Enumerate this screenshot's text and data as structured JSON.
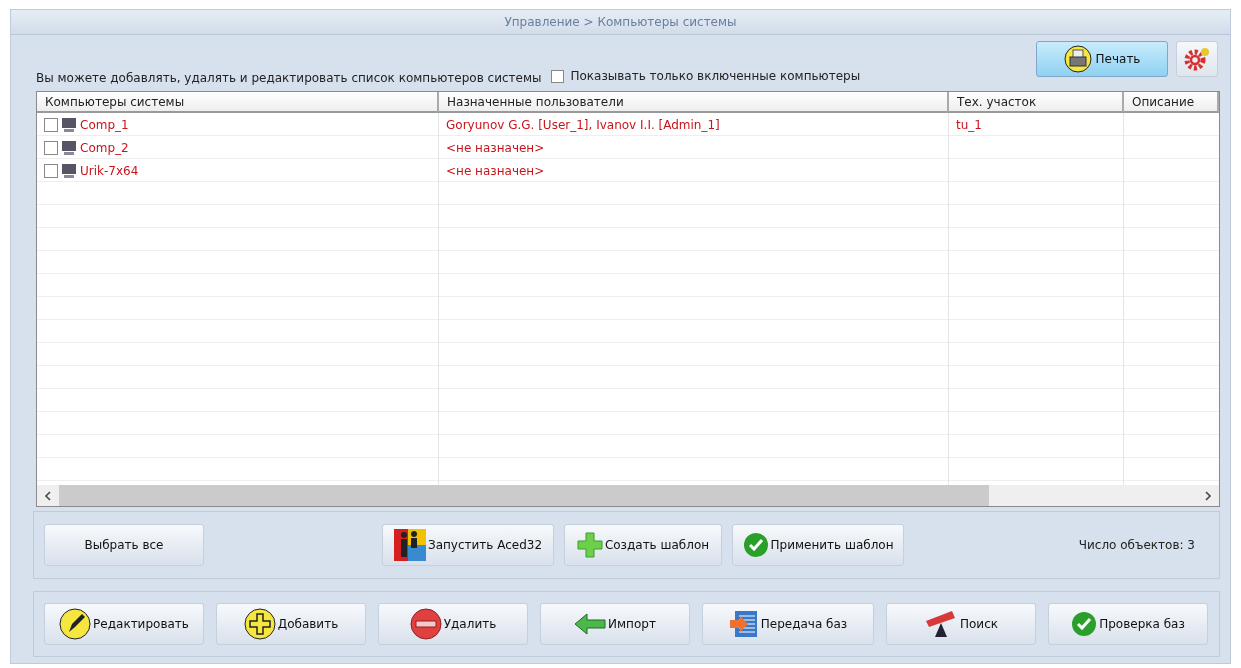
{
  "breadcrumb": "Управление > Компьютеры системы",
  "hint": "Вы можете добавлять, удалять и редактировать список компьютеров системы",
  "filter": {
    "label": "Показывать только включенные компьютеры",
    "checked": false
  },
  "print_button": "Печать",
  "table": {
    "columns": [
      "Компьютеры системы",
      "Назначенные пользователи",
      "Тех. участок",
      "Описание"
    ],
    "rows": [
      {
        "checked": false,
        "name": "Comp_1",
        "users": "Goryunov G.G. [User_1], Ivanov I.I. [Admin_1]",
        "area": "tu_1"
      },
      {
        "checked": false,
        "name": "Comp_2",
        "users": "<не назначен>"
      },
      {
        "checked": false,
        "name": "Urik-7x64",
        "users": "<не назначен>"
      }
    ]
  },
  "middle_buttons": [
    {
      "kind": "none",
      "label": "Выбрать все"
    },
    {
      "kind": "people",
      "label": "Запустить Aced32"
    },
    {
      "kind": "cross",
      "label": "Создать шаблон"
    },
    {
      "kind": "check",
      "label": "Применить шаблон"
    }
  ],
  "count": "Число объектов: 3",
  "bottom_buttons": [
    {
      "kind": "pen",
      "label": "Редактировать"
    },
    {
      "kind": "plus",
      "label": "Добавить"
    },
    {
      "kind": "minus",
      "label": "Удалить"
    },
    {
      "kind": "arrow",
      "label": "Импорт"
    },
    {
      "kind": "transfer",
      "label": "Передача баз"
    },
    {
      "kind": "telescope",
      "label": "Поиск"
    },
    {
      "kind": "check",
      "label": "Проверка баз"
    }
  ]
}
